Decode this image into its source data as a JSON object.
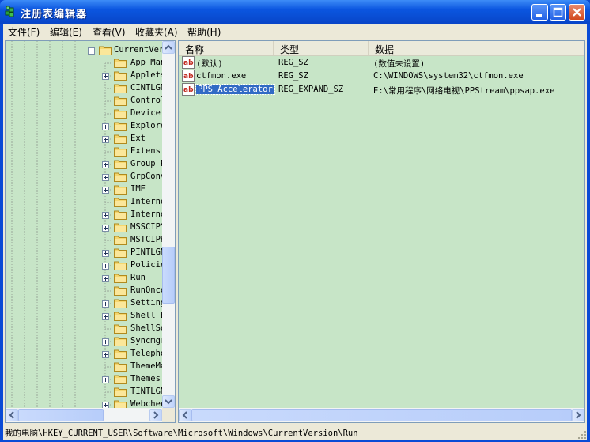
{
  "window": {
    "title": "注册表编辑器"
  },
  "menu": [
    "文件(F)",
    "编辑(E)",
    "查看(V)",
    "收藏夹(A)",
    "帮助(H)"
  ],
  "tree": {
    "parent": "CurrentVersion",
    "children": [
      {
        "label": "App Management",
        "expandable": false
      },
      {
        "label": "Applets",
        "expandable": true
      },
      {
        "label": "CINTLGNT",
        "expandable": false
      },
      {
        "label": "Controls Folder",
        "expandable": false
      },
      {
        "label": "Device Metadata",
        "expandable": false
      },
      {
        "label": "Explorer",
        "expandable": true
      },
      {
        "label": "Ext",
        "expandable": true
      },
      {
        "label": "Extensions",
        "expandable": false
      },
      {
        "label": "Group Policy",
        "expandable": true
      },
      {
        "label": "GrpConv",
        "expandable": true
      },
      {
        "label": "IME",
        "expandable": true
      },
      {
        "label": "Internet",
        "expandable": false
      },
      {
        "label": "Internet Settings",
        "expandable": true
      },
      {
        "label": "MSSCIPY",
        "expandable": true
      },
      {
        "label": "MSTCIPH",
        "expandable": false
      },
      {
        "label": "PINTLGNT",
        "expandable": true
      },
      {
        "label": "Policies",
        "expandable": true
      },
      {
        "label": "Run",
        "expandable": true
      },
      {
        "label": "RunOnce",
        "expandable": false
      },
      {
        "label": "Settings",
        "expandable": true
      },
      {
        "label": "Shell Extensions",
        "expandable": true
      },
      {
        "label": "ShellServiceObjects",
        "expandable": false
      },
      {
        "label": "Syncmgr",
        "expandable": true
      },
      {
        "label": "Telephony",
        "expandable": true
      },
      {
        "label": "ThemeManager",
        "expandable": false
      },
      {
        "label": "Themes",
        "expandable": true
      },
      {
        "label": "TINTLGNT",
        "expandable": false
      },
      {
        "label": "Webcheck",
        "expandable": true
      }
    ]
  },
  "list": {
    "columns": [
      "名称",
      "类型",
      "数据"
    ],
    "rows": [
      {
        "name": "(默认)",
        "type": "REG_SZ",
        "data": "(数值未设置)",
        "selected": false
      },
      {
        "name": "ctfmon.exe",
        "type": "REG_SZ",
        "data": "C:\\WINDOWS\\system32\\ctfmon.exe",
        "selected": false
      },
      {
        "name": "PPS Accelerator",
        "type": "REG_EXPAND_SZ",
        "data": "E:\\常用程序\\网络电视\\PPStream\\ppsap.exe",
        "selected": true
      }
    ]
  },
  "status": {
    "path": "我的电脑\\HKEY_CURRENT_USER\\Software\\Microsoft\\Windows\\CurrentVersion\\Run"
  },
  "colors": {
    "titlebar": "#0b56e0",
    "pane_bg": "#c7e5c7",
    "selection": "#316ac5",
    "chrome": "#ece9d8"
  },
  "icons": [
    "registry-editor-icon",
    "minimize-icon",
    "maximize-icon",
    "close-icon",
    "folder-icon",
    "plus-icon",
    "minus-icon",
    "string-value-icon",
    "arrow-up-icon",
    "arrow-down-icon",
    "arrow-left-icon",
    "arrow-right-icon",
    "resize-grip-icon"
  ]
}
